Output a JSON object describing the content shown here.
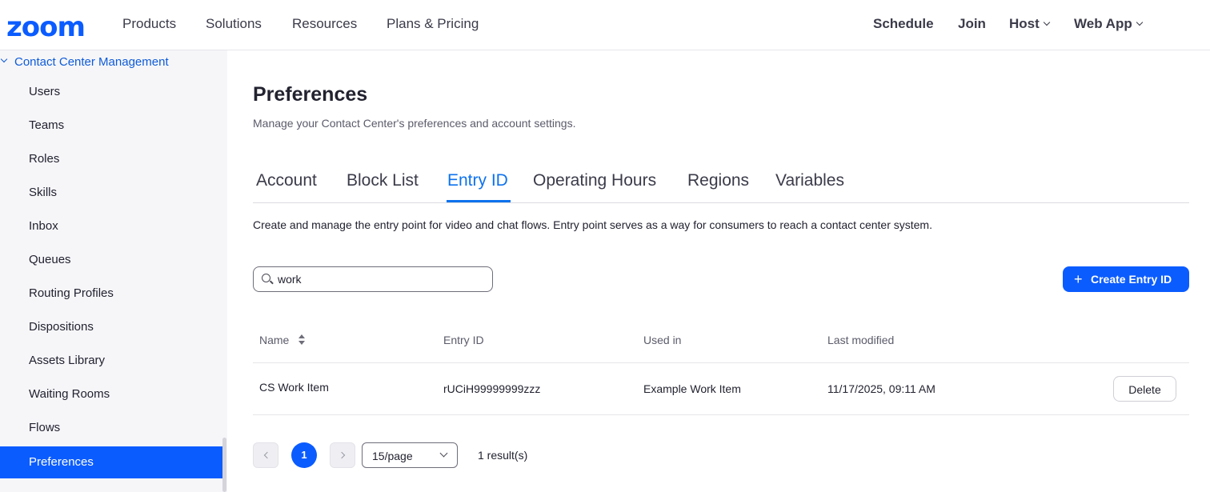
{
  "header": {
    "logo": "zoom",
    "nav": [
      "Products",
      "Solutions",
      "Resources",
      "Plans & Pricing"
    ],
    "right": {
      "schedule": "Schedule",
      "join": "Join",
      "host": "Host",
      "web_app": "Web App"
    }
  },
  "sidebar": {
    "section": "Contact Center Management",
    "items": [
      {
        "label": "Users"
      },
      {
        "label": "Teams"
      },
      {
        "label": "Roles"
      },
      {
        "label": "Skills"
      },
      {
        "label": "Inbox"
      },
      {
        "label": "Queues"
      },
      {
        "label": "Routing Profiles"
      },
      {
        "label": "Dispositions"
      },
      {
        "label": "Assets Library"
      },
      {
        "label": "Waiting Rooms"
      },
      {
        "label": "Flows"
      },
      {
        "label": "Preferences",
        "active": true
      }
    ]
  },
  "main": {
    "title": "Preferences",
    "subtitle": "Manage your Contact Center's preferences and account settings.",
    "tabs": [
      "Account",
      "Block List",
      "Entry ID",
      "Operating Hours",
      "Regions",
      "Variables"
    ],
    "active_tab": "Entry ID",
    "description": "Create and manage the entry point for video and chat flows. Entry point serves as a way for consumers to reach a contact center system.",
    "search": {
      "value": "work"
    },
    "create_button": "Create Entry ID",
    "table": {
      "columns": [
        "Name",
        "Entry ID",
        "Used in",
        "Last modified"
      ],
      "rows": [
        {
          "name": "CS Work Item",
          "entry_id": "rUCiH99999999zzz",
          "used_in": "Example Work Item",
          "last_modified": "11/17/2025, 09:11 AM",
          "action": "Delete"
        }
      ]
    },
    "pagination": {
      "current_page": "1",
      "page_size": "15/page",
      "result_count": "1 result(s)"
    }
  },
  "colors": {
    "brand": "#0b5cff",
    "active_tab": "#0e72ed",
    "sidebar_bg": "#f6f6f9"
  }
}
